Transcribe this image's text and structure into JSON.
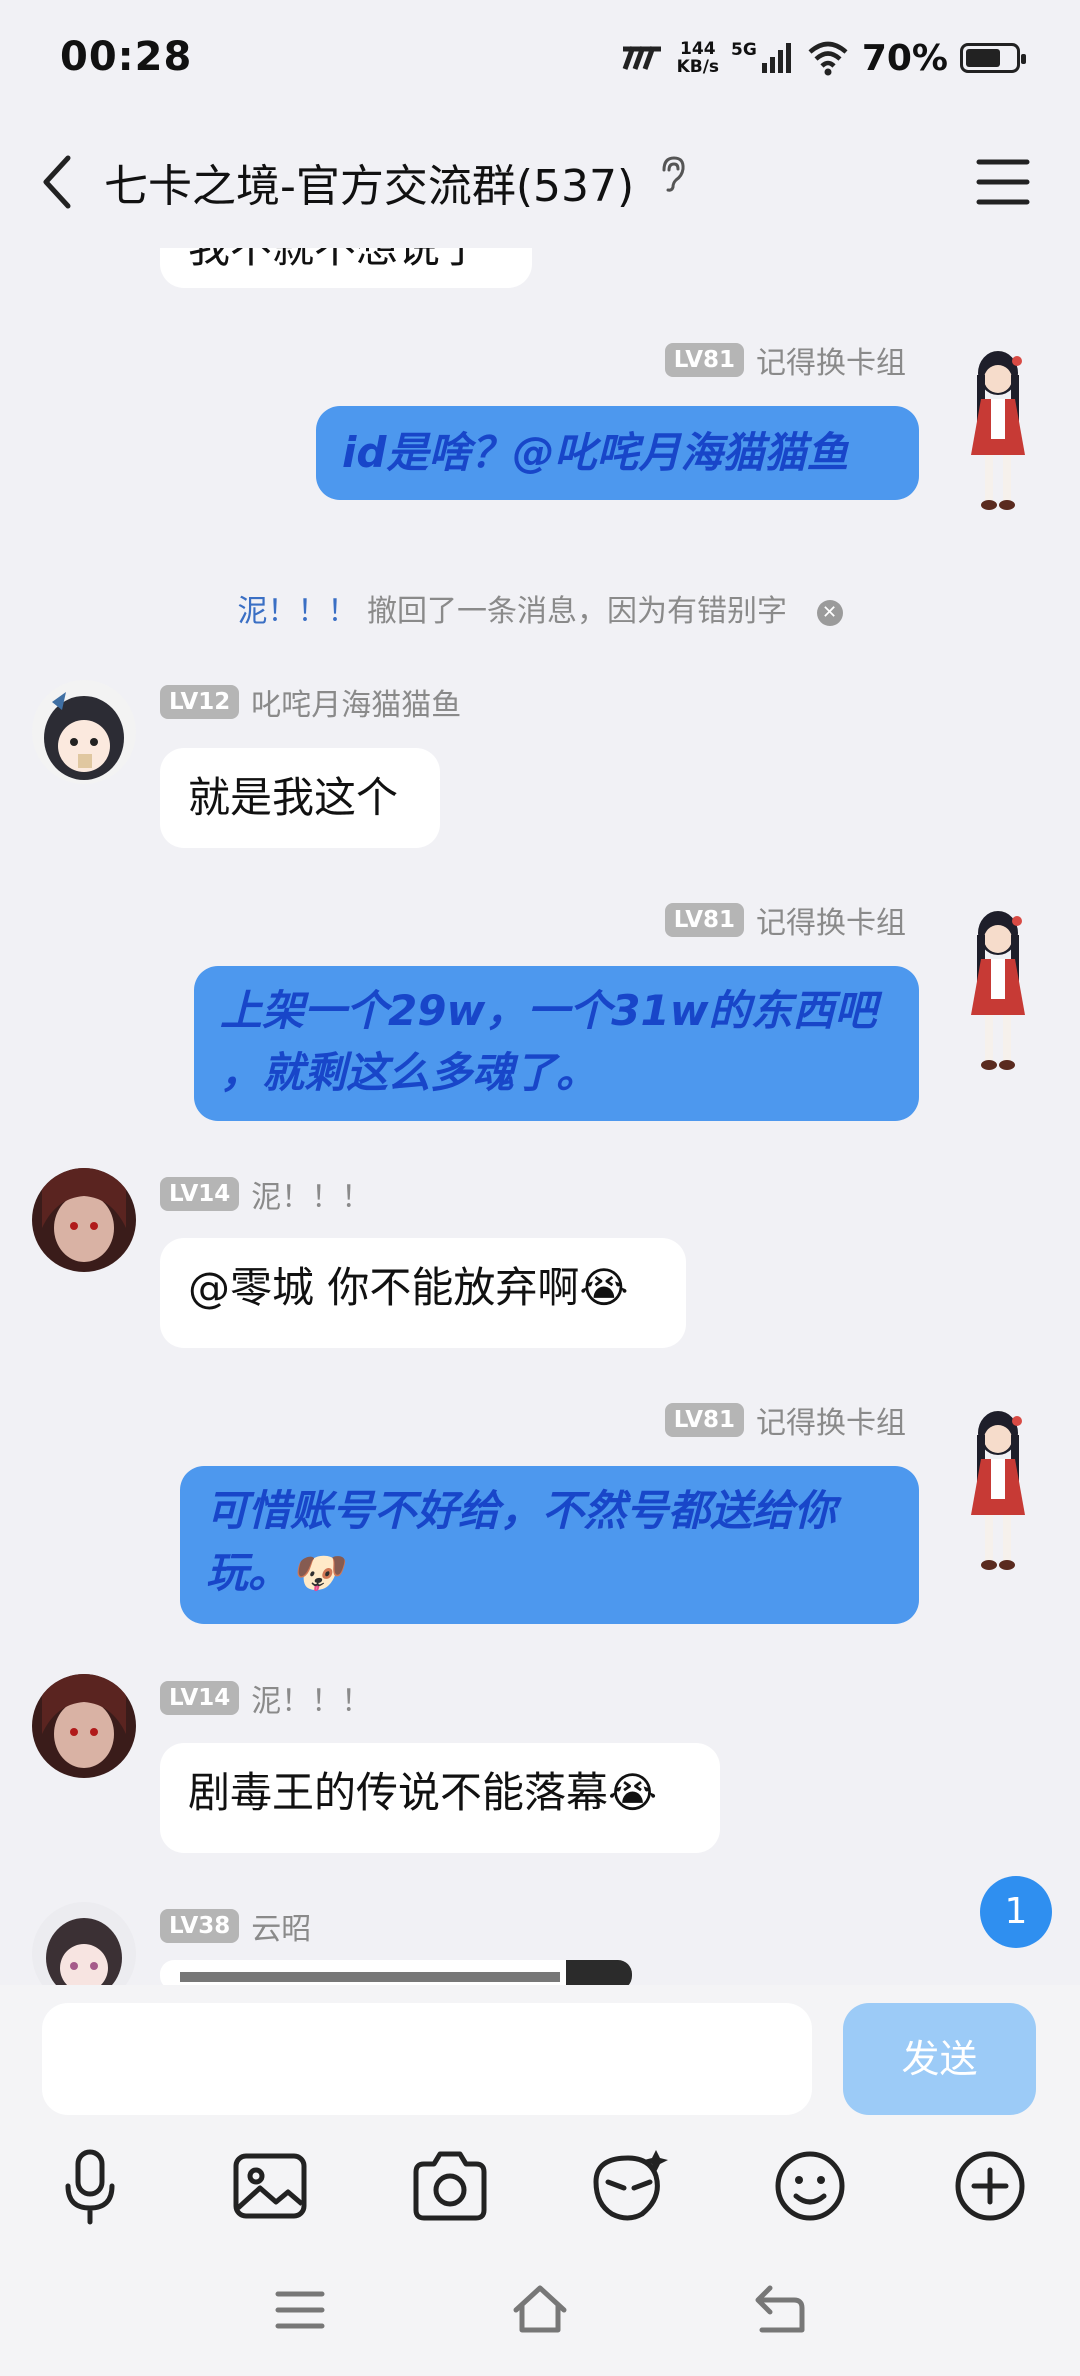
{
  "status_bar": {
    "time": "00:28",
    "net_speed_value": "144",
    "net_speed_unit": "KB/s",
    "signal": "5G",
    "battery_percent": "70%",
    "battery_level": 0.7
  },
  "header": {
    "title": "七卡之境-官方交流群(537)"
  },
  "cropped_top_text": "我不就不想说了",
  "messages": [
    {
      "level": "LV81",
      "sender": "记得换卡组",
      "text": "id是啥？@叱咤月海猫猫鱼"
    },
    {
      "level": "LV12",
      "sender": "叱咤月海猫猫鱼",
      "text": "就是我这个"
    },
    {
      "level": "LV81",
      "sender": "记得换卡组",
      "text_line1": "上架一个29w，一个31w的东西吧",
      "text_line2": "，就剩这么多魂了。"
    },
    {
      "level": "LV14",
      "sender": "泥！！！",
      "text": "@零城 你不能放弃啊😭"
    },
    {
      "level": "LV81",
      "sender": "记得换卡组",
      "text_line1": "可惜账号不好给，不然号都送给你",
      "text_line2": "玩。🐶"
    },
    {
      "level": "LV14",
      "sender": "泥！！！",
      "text": "剧毒王的传说不能落幕😭"
    },
    {
      "level": "LV38",
      "sender": "云昭"
    }
  ],
  "recall_notice": {
    "name": "泥！！！",
    "text": "撤回了一条消息，因为有错别字"
  },
  "unread_count": "1",
  "composer": {
    "input_value": "",
    "send_label": "发送"
  },
  "colors": {
    "background": "#f1f1f5",
    "outgoing_bubble": "#4d98ee",
    "outgoing_text": "#1846c9",
    "send_button": "#9ccbf7",
    "unread_badge": "#2f8ff0"
  },
  "icons": [
    "back-icon",
    "hearing-icon",
    "menu-icon",
    "mic-icon",
    "image-icon",
    "camera-icon",
    "sticker-icon",
    "emoji-icon",
    "plus-icon",
    "nav-menu-icon",
    "nav-home-icon",
    "nav-back-icon"
  ]
}
